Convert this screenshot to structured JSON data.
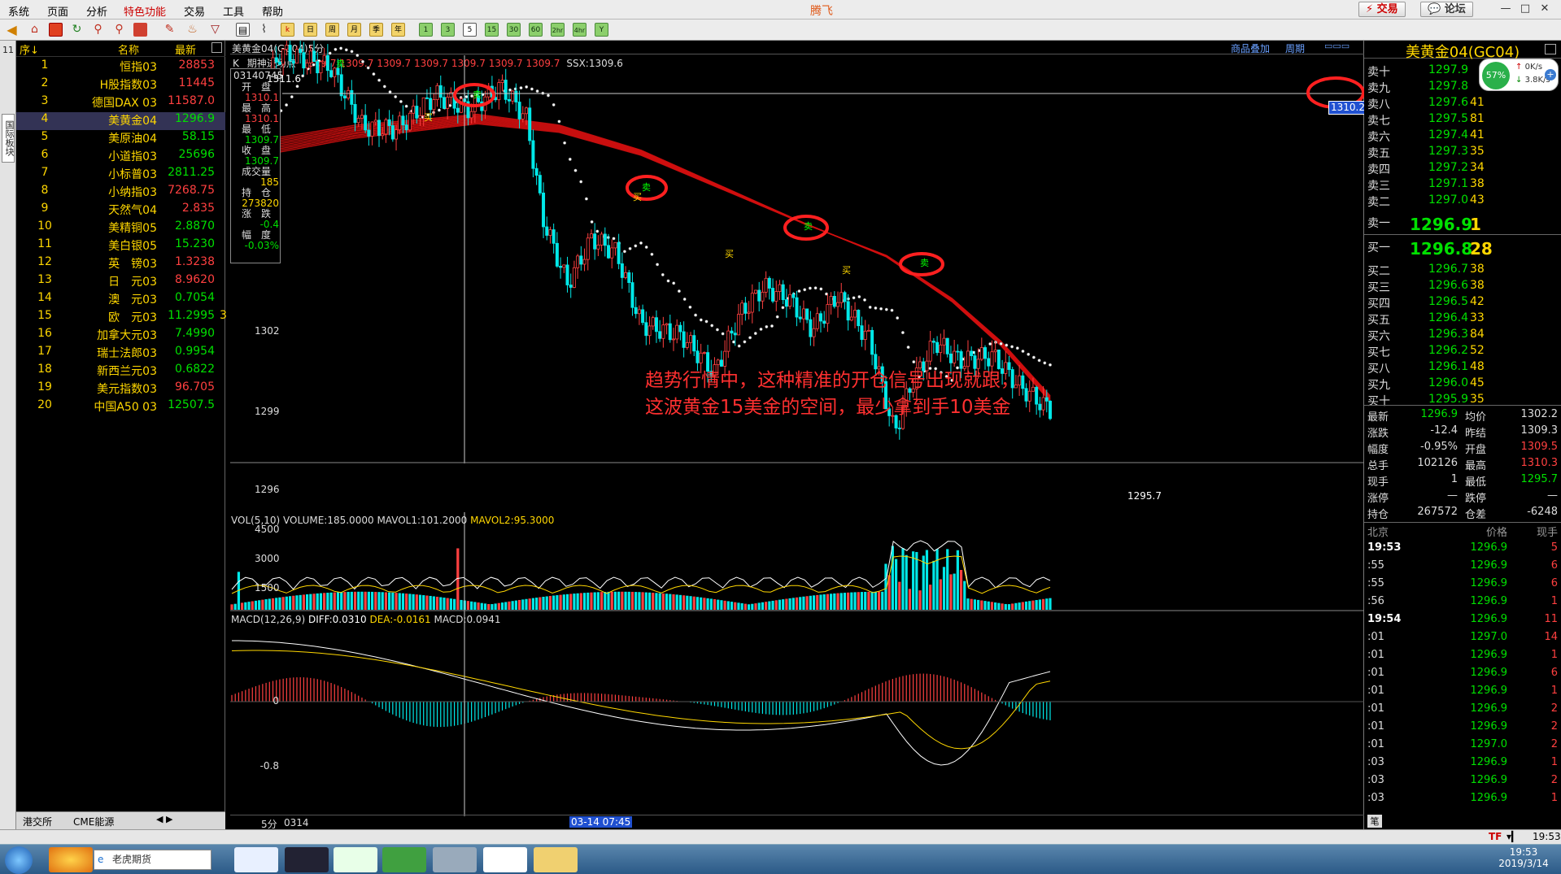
{
  "menu": {
    "items": [
      "系统",
      "页面",
      "分析",
      "特色功能",
      "交易",
      "工具",
      "帮助"
    ],
    "active_index": 3,
    "app_title": "腾飞",
    "trade_button": "交易",
    "forum_button": "论坛",
    "minimize": "—",
    "maximize": "□",
    "close": "✕"
  },
  "toolbar": {
    "buttons": [
      "1",
      "3",
      "5",
      "15",
      "30",
      "60",
      "2hr",
      "4hr",
      "Y"
    ],
    "selected": "5",
    "period_buttons": [
      "日",
      "周",
      "月",
      "季",
      "年"
    ]
  },
  "left_strip": {
    "top_text": "11",
    "tab_text": "国际板块"
  },
  "watchlist": {
    "headers": {
      "no": "序↓",
      "name": "名称",
      "latest": "最新"
    },
    "rows": [
      {
        "no": "1",
        "name": "恒指03",
        "latest": "28853",
        "dir": "up"
      },
      {
        "no": "2",
        "name": "H股指数03",
        "latest": "11445",
        "dir": "up"
      },
      {
        "no": "3",
        "name": "德国DAX 03",
        "latest": "11587.0",
        "dir": "up"
      },
      {
        "no": "4",
        "name": "美黄金04",
        "latest": "1296.9",
        "dir": "dn"
      },
      {
        "no": "5",
        "name": "美原油04",
        "latest": "58.15",
        "dir": "dn"
      },
      {
        "no": "6",
        "name": "小道指03",
        "latest": "25696",
        "dir": "dn"
      },
      {
        "no": "7",
        "name": "小标普03",
        "latest": "2811.25",
        "dir": "dn"
      },
      {
        "no": "8",
        "name": "小纳指03",
        "latest": "7268.75",
        "dir": "up"
      },
      {
        "no": "9",
        "name": "天然气04",
        "latest": "2.835",
        "dir": "up"
      },
      {
        "no": "10",
        "name": "美精铜05",
        "latest": "2.8870",
        "dir": "dn"
      },
      {
        "no": "11",
        "name": "美白银05",
        "latest": "15.230",
        "dir": "dn"
      },
      {
        "no": "12",
        "name": "英　镑03",
        "latest": "1.3238",
        "dir": "up"
      },
      {
        "no": "13",
        "name": "日　元03",
        "latest": "8.9620",
        "dir": "up"
      },
      {
        "no": "14",
        "name": "澳　元03",
        "latest": "0.7054",
        "dir": "dn"
      },
      {
        "no": "15",
        "name": "欧　元03",
        "latest": "11.2995",
        "dir": "dn"
      },
      {
        "no": "16",
        "name": "加拿大元03",
        "latest": "7.4990",
        "dir": "dn"
      },
      {
        "no": "17",
        "name": "瑞士法郎03",
        "latest": "0.9954",
        "dir": "dn"
      },
      {
        "no": "18",
        "name": "新西兰元03",
        "latest": "0.6822",
        "dir": "dn"
      },
      {
        "no": "19",
        "name": "美元指数03",
        "latest": "96.705",
        "dir": "up"
      },
      {
        "no": "20",
        "name": "中国A50 03",
        "latest": "12507.5",
        "dir": "dn"
      }
    ],
    "selected_index": 3,
    "row15_extra": "3",
    "footer_tabs": [
      "港交所",
      "CME能源"
    ]
  },
  "chart": {
    "header_title": "美黄金04(GC04)5分",
    "header_right": [
      "商品叠加",
      "周期"
    ],
    "indicator_line": {
      "k": "K",
      "name": "期神进场点",
      "vals": [
        "1309.7",
        "1309.7",
        "1309.7",
        "1309.7",
        "1309.7",
        "1309.7",
        "1309.7"
      ],
      "ssx": "SSX:1309.6"
    },
    "infobox": {
      "date": "03140745",
      "open_l": "开　盘",
      "open": "1310.1",
      "high_l": "最　高",
      "high": "1310.1",
      "low_l": "最　低",
      "low": "1309.7",
      "close_l": "收　盘",
      "close": "1309.7",
      "vol_l": "成交量",
      "vol": "185",
      "oi_l": "持　仓",
      "oi": "273820",
      "chg_l": "涨　跌",
      "chg": "-0.4",
      "pct_l": "幅　度",
      "pct": "-0.03%"
    },
    "y_labels": [
      "1302",
      "1299",
      "1296"
    ],
    "crosshair_price": "1310.2",
    "high_label": "1311.6",
    "low_label": "1295.7",
    "buy_mark": "买",
    "sell_mark": "卖",
    "annotation": [
      "趋势行情中，这种精准的开仓信号出现就跟，",
      "这波黄金15美金的空间，最少拿到手10美金"
    ],
    "vol": {
      "title": "VOL(5,10)",
      "volume": "VOLUME:185.0000",
      "mavol1": "MAVOL1:101.2000",
      "mavol2": "MAVOL2:95.3000",
      "y_labels": [
        "4500",
        "3000",
        "1500"
      ]
    },
    "macd": {
      "title": "MACD(12,26,9)",
      "diff": "DIFF:0.0310",
      "dea": "DEA:-0.0161",
      "macd": "MACD:0.0941",
      "y_labels": [
        "0",
        "-0.8"
      ]
    },
    "bottom": {
      "period": "5分",
      "date": "0314",
      "cursor_time": "03-14 07:45"
    }
  },
  "quote": {
    "title": "美黄金04(GC04)",
    "net": {
      "pct": "57%",
      "up": "0K/s",
      "down": "3.8K/s"
    },
    "asks": [
      {
        "l": "卖十",
        "p": "1297.9",
        "v": ""
      },
      {
        "l": "卖九",
        "p": "1297.8",
        "v": ""
      },
      {
        "l": "卖八",
        "p": "1297.6",
        "v": "41"
      },
      {
        "l": "卖七",
        "p": "1297.5",
        "v": "81"
      },
      {
        "l": "卖六",
        "p": "1297.4",
        "v": "41"
      },
      {
        "l": "卖五",
        "p": "1297.3",
        "v": "35"
      },
      {
        "l": "卖四",
        "p": "1297.2",
        "v": "34"
      },
      {
        "l": "卖三",
        "p": "1297.1",
        "v": "38"
      },
      {
        "l": "卖二",
        "p": "1297.0",
        "v": "43"
      }
    ],
    "ask1": {
      "l": "卖一",
      "p": "1296.9",
      "v": "1"
    },
    "bid1": {
      "l": "买一",
      "p": "1296.8",
      "v": "28"
    },
    "bids": [
      {
        "l": "买二",
        "p": "1296.7",
        "v": "38"
      },
      {
        "l": "买三",
        "p": "1296.6",
        "v": "38"
      },
      {
        "l": "买四",
        "p": "1296.5",
        "v": "42"
      },
      {
        "l": "买五",
        "p": "1296.4",
        "v": "33"
      },
      {
        "l": "买六",
        "p": "1296.3",
        "v": "84"
      },
      {
        "l": "买七",
        "p": "1296.2",
        "v": "52"
      },
      {
        "l": "买八",
        "p": "1296.1",
        "v": "48"
      },
      {
        "l": "买九",
        "p": "1296.0",
        "v": "45"
      },
      {
        "l": "买十",
        "p": "1295.9",
        "v": "35"
      }
    ],
    "stats": [
      {
        "k1": "最新",
        "v1": "1296.9",
        "c1": "dn",
        "k2": "均价",
        "v2": "1302.2",
        "c2": "wh"
      },
      {
        "k1": "涨跌",
        "v1": "-12.4",
        "c1": "wh",
        "k2": "昨结",
        "v2": "1309.3",
        "c2": "wh"
      },
      {
        "k1": "幅度",
        "v1": "-0.95%",
        "c1": "wh",
        "k2": "开盘",
        "v2": "1309.5",
        "c2": "up"
      },
      {
        "k1": "总手",
        "v1": "102126",
        "c1": "wh",
        "k2": "最高",
        "v2": "1310.3",
        "c2": "up"
      },
      {
        "k1": "现手",
        "v1": "1",
        "c1": "wh",
        "k2": "最低",
        "v2": "1295.7",
        "c2": "dn"
      },
      {
        "k1": "涨停",
        "v1": "—",
        "c1": "wh",
        "k2": "跌停",
        "v2": "—",
        "c2": "wh"
      },
      {
        "k1": "持仓",
        "v1": "267572",
        "c1": "wh",
        "k2": "仓差",
        "v2": "-6248",
        "c2": "wh"
      }
    ],
    "tick_header": {
      "loc": "北京",
      "price": "价格",
      "qty": "现手"
    },
    "ticks": [
      {
        "t": "19:53",
        "p": "1296.9",
        "q": "5",
        "bold": true
      },
      {
        "t": ":55",
        "p": "1296.9",
        "q": "6"
      },
      {
        "t": ":55",
        "p": "1296.9",
        "q": "6"
      },
      {
        "t": ":56",
        "p": "1296.9",
        "q": "1"
      },
      {
        "t": "19:54",
        "p": "1296.9",
        "q": "11",
        "bold": true
      },
      {
        "t": ":01",
        "p": "1297.0",
        "q": "14"
      },
      {
        "t": ":01",
        "p": "1296.9",
        "q": "1"
      },
      {
        "t": ":01",
        "p": "1296.9",
        "q": "6"
      },
      {
        "t": ":01",
        "p": "1296.9",
        "q": "1"
      },
      {
        "t": ":01",
        "p": "1296.9",
        "q": "2"
      },
      {
        "t": ":01",
        "p": "1296.9",
        "q": "2"
      },
      {
        "t": ":01",
        "p": "1297.0",
        "q": "2"
      },
      {
        "t": ":03",
        "p": "1296.9",
        "q": "1"
      },
      {
        "t": ":03",
        "p": "1296.9",
        "q": "2"
      },
      {
        "t": ":03",
        "p": "1296.9",
        "q": "1"
      }
    ],
    "footer": "笔"
  },
  "status": {
    "right_time": "19:53",
    "tf": "TF"
  },
  "taskbar": {
    "search_text": "老虎期货",
    "time": "19:53",
    "date": "2019/3/14"
  },
  "colors": {
    "up": "#ff4040",
    "down": "#00e000",
    "accent": "#ffd700",
    "ribbon": "#d01010",
    "cyan": "#00e8e8",
    "highlight_circle": "#ff2020"
  }
}
